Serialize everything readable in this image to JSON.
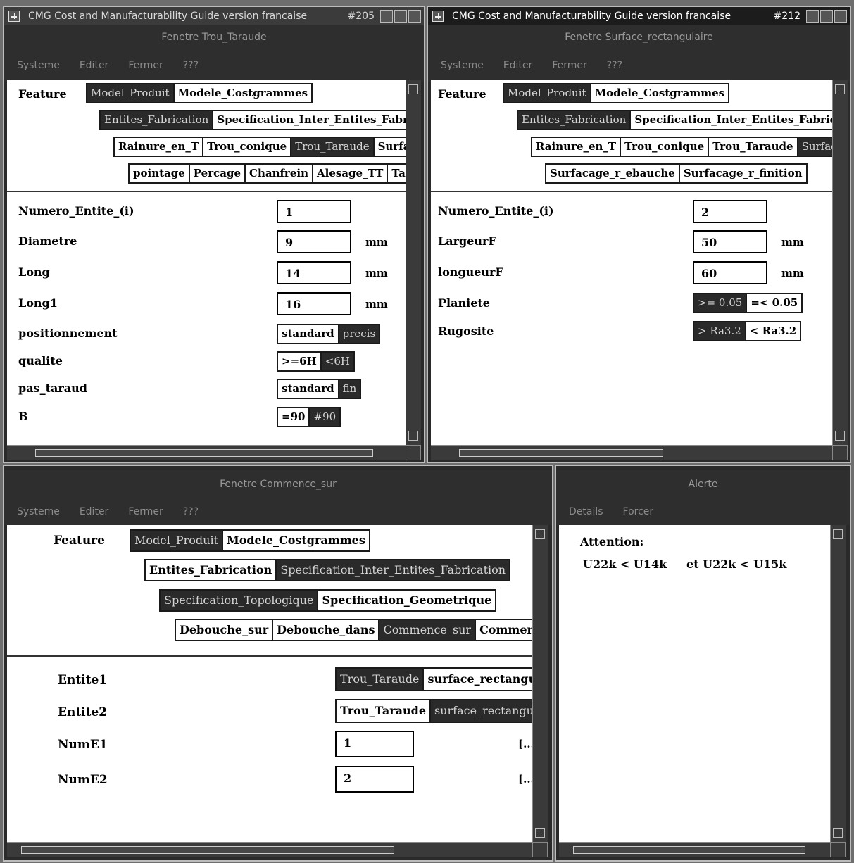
{
  "win1": {
    "title": "CMG Cost and Manufacturability Guide version francaise",
    "number": "#205",
    "subtitle": "Fenetre Trou_Taraude",
    "menu": [
      "Systeme",
      "Editer",
      "Fermer",
      "???"
    ],
    "feature_label": "Feature",
    "row1": [
      "Model_Produit",
      "Modele_Costgrammes"
    ],
    "row2": [
      "Entites_Fabrication",
      "Specification_Inter_Entites_Fabrica"
    ],
    "row3": [
      "Rainure_en_T",
      "Trou_conique",
      "Trou_Taraude",
      "Surfa"
    ],
    "row4": [
      "pointage",
      "Percage",
      "Chanfrein",
      "Alesage_TT",
      "Tar"
    ],
    "fields": [
      {
        "label": "Numero_Entite_(i)",
        "value": "1",
        "unit": ""
      },
      {
        "label": "Diametre",
        "value": "9",
        "unit": "mm"
      },
      {
        "label": "Long",
        "value": "14",
        "unit": "mm"
      },
      {
        "label": "Long1",
        "value": "16",
        "unit": "mm"
      }
    ],
    "options": [
      {
        "label": "positionnement",
        "choices": [
          "standard",
          "precis"
        ]
      },
      {
        "label": "qualite",
        "choices": [
          ">=6H",
          "<6H"
        ]
      },
      {
        "label": "pas_taraud",
        "choices": [
          "standard",
          "fin"
        ]
      },
      {
        "label": "B",
        "choices": [
          "=90",
          "#90"
        ]
      }
    ]
  },
  "win2": {
    "title": "CMG Cost and Manufacturability Guide version francaise",
    "number": "#212",
    "subtitle": "Fenetre Surface_rectangulaire",
    "menu": [
      "Systeme",
      "Editer",
      "Fermer",
      "???"
    ],
    "feature_label": "Feature",
    "row1": [
      "Model_Produit",
      "Modele_Costgrammes"
    ],
    "row2": [
      "Entites_Fabrication",
      "Specification_Inter_Entites_Fabricati"
    ],
    "row3": [
      "Rainure_en_T",
      "Trou_conique",
      "Trou_Taraude",
      "Surface"
    ],
    "row4": [
      "Surfacage_r_ebauche",
      "Surfacage_r_finition"
    ],
    "fields": [
      {
        "label": "Numero_Entite_(i)",
        "value": "2",
        "unit": ""
      },
      {
        "label": "LargeurF",
        "value": "50",
        "unit": "mm"
      },
      {
        "label": "longueurF",
        "value": "60",
        "unit": "mm"
      }
    ],
    "options": [
      {
        "label": "Planiete",
        "choices": [
          ">= 0.05",
          "=< 0.05"
        ]
      },
      {
        "label": "Rugosite",
        "choices": [
          "> Ra3.2",
          "< Ra3.2"
        ]
      }
    ]
  },
  "win3": {
    "subtitle": "Fenetre Commence_sur",
    "menu": [
      "Systeme",
      "Editer",
      "Fermer",
      "???"
    ],
    "feature_label": "Feature",
    "row1": [
      "Model_Produit",
      "Modele_Costgrammes"
    ],
    "row2": [
      "Entites_Fabrication",
      "Specification_Inter_Entites_Fabrication"
    ],
    "row3": [
      "Specification_Topologique",
      "Specification_Geometrique"
    ],
    "row4": [
      "Debouche_sur",
      "Debouche_dans",
      "Commence_sur",
      "Commen"
    ],
    "entite1": {
      "label": "Entite1",
      "choices": [
        "Trou_Taraude",
        "surface_rectangu"
      ]
    },
    "entite2": {
      "label": "Entite2",
      "choices": [
        "Trou_Taraude",
        "surface_rectangu"
      ]
    },
    "nume1": {
      "label": "NumE1",
      "value": "1",
      "more": "[..."
    },
    "nume2": {
      "label": "NumE2",
      "value": "2",
      "more": "[..."
    }
  },
  "win4": {
    "subtitle": "Alerte",
    "menu": [
      "Details",
      "Forcer"
    ],
    "attention": "Attention:",
    "message": "U22k < U14k     et U22k < U15k"
  }
}
